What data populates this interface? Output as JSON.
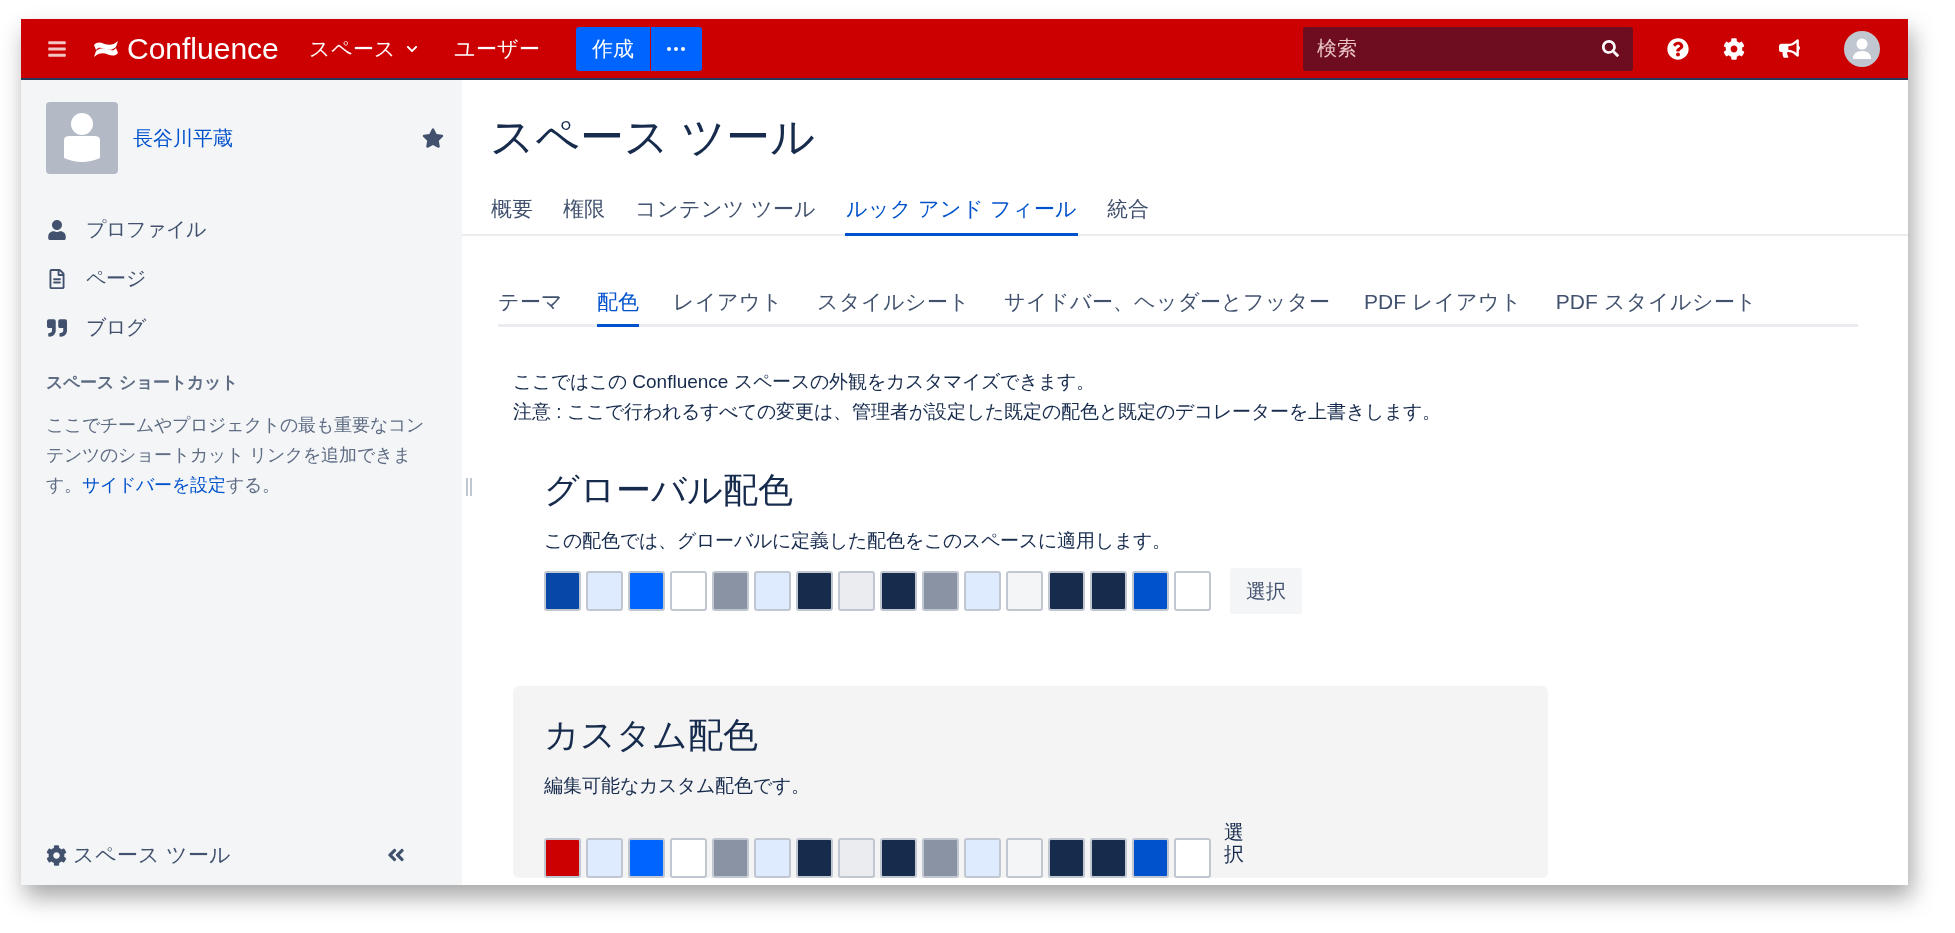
{
  "header": {
    "product": "Confluence",
    "nav": [
      {
        "label": "スペース",
        "dropdown": true
      },
      {
        "label": "ユーザー",
        "dropdown": false
      }
    ],
    "create_button": "作成",
    "search": {
      "placeholder": "検索"
    }
  },
  "sidebar": {
    "space_name": "長谷川平蔵",
    "starred": true,
    "items": [
      {
        "kind": "profile",
        "label": "プロファイル"
      },
      {
        "kind": "pages",
        "label": "ページ"
      },
      {
        "kind": "blog",
        "label": "ブログ"
      }
    ],
    "shortcuts": {
      "title": "スペース ショートカット",
      "text": "ここでチームやプロジェクトの最も重要なコンテンツのショートカット リンクを追加できます。",
      "link": "サイドバーを設定",
      "suffix": "する。"
    },
    "footer": "スペース ツール"
  },
  "main": {
    "title": "スペース ツール",
    "tabs": [
      {
        "label": "概要",
        "selected": false
      },
      {
        "label": "権限",
        "selected": false
      },
      {
        "label": "コンテンツ ツール",
        "selected": false
      },
      {
        "label": "ルック アンド フィール",
        "selected": true
      },
      {
        "label": "統合",
        "selected": false
      }
    ],
    "subtabs": [
      {
        "label": "テーマ",
        "selected": false
      },
      {
        "label": "配色",
        "selected": true
      },
      {
        "label": "レイアウト",
        "selected": false
      },
      {
        "label": "スタイルシート",
        "selected": false
      },
      {
        "label": "サイドバー、ヘッダーとフッター",
        "selected": false
      },
      {
        "label": "PDF レイアウト",
        "selected": false
      },
      {
        "label": "PDF スタイルシート",
        "selected": false
      }
    ],
    "description": [
      "ここではこの Confluence スペースの外観をカスタマイズできます。",
      "注意 : ここで行われるすべての変更は、管理者が設定した既定の配色と既定のデコレーターを上書きします。"
    ],
    "global_scheme": {
      "title": "グローバル配色",
      "description": "この配色では、グローバルに定義した配色をこのスペースに適用します。",
      "select_button": "選択",
      "swatches": [
        {
          "color": "#0747a6"
        },
        {
          "color": "#deebff"
        },
        {
          "color": "#0065ff"
        },
        {
          "color": "#ffffff"
        },
        {
          "color": "#8993a4"
        },
        {
          "color": "#deebff"
        },
        {
          "color": "#172b4d"
        },
        {
          "color": "#ebecf0"
        },
        {
          "color": "#172b4d"
        },
        {
          "color": "#8993a4"
        },
        {
          "color": "#deebff"
        },
        {
          "color": "#f4f5f7"
        },
        {
          "color": "#172b4d"
        },
        {
          "color": "#172b4d"
        },
        {
          "color": "#0052cc"
        },
        {
          "color": "#ffffff"
        }
      ]
    },
    "custom_scheme": {
      "title": "カスタム配色",
      "description": "編集可能なカスタム配色です。",
      "status": "選択",
      "swatches": [
        {
          "color": "#cc0000"
        },
        {
          "color": "#deebff"
        },
        {
          "color": "#0065ff"
        },
        {
          "color": "#ffffff"
        },
        {
          "color": "#8993a4"
        },
        {
          "color": "#deebff"
        },
        {
          "color": "#172b4d"
        },
        {
          "color": "#ebecf0"
        },
        {
          "color": "#172b4d"
        },
        {
          "color": "#8993a4"
        },
        {
          "color": "#deebff"
        },
        {
          "color": "#f4f5f7"
        },
        {
          "color": "#172b4d"
        },
        {
          "color": "#172b4d"
        },
        {
          "color": "#0052cc"
        },
        {
          "color": "#ffffff"
        }
      ]
    }
  }
}
